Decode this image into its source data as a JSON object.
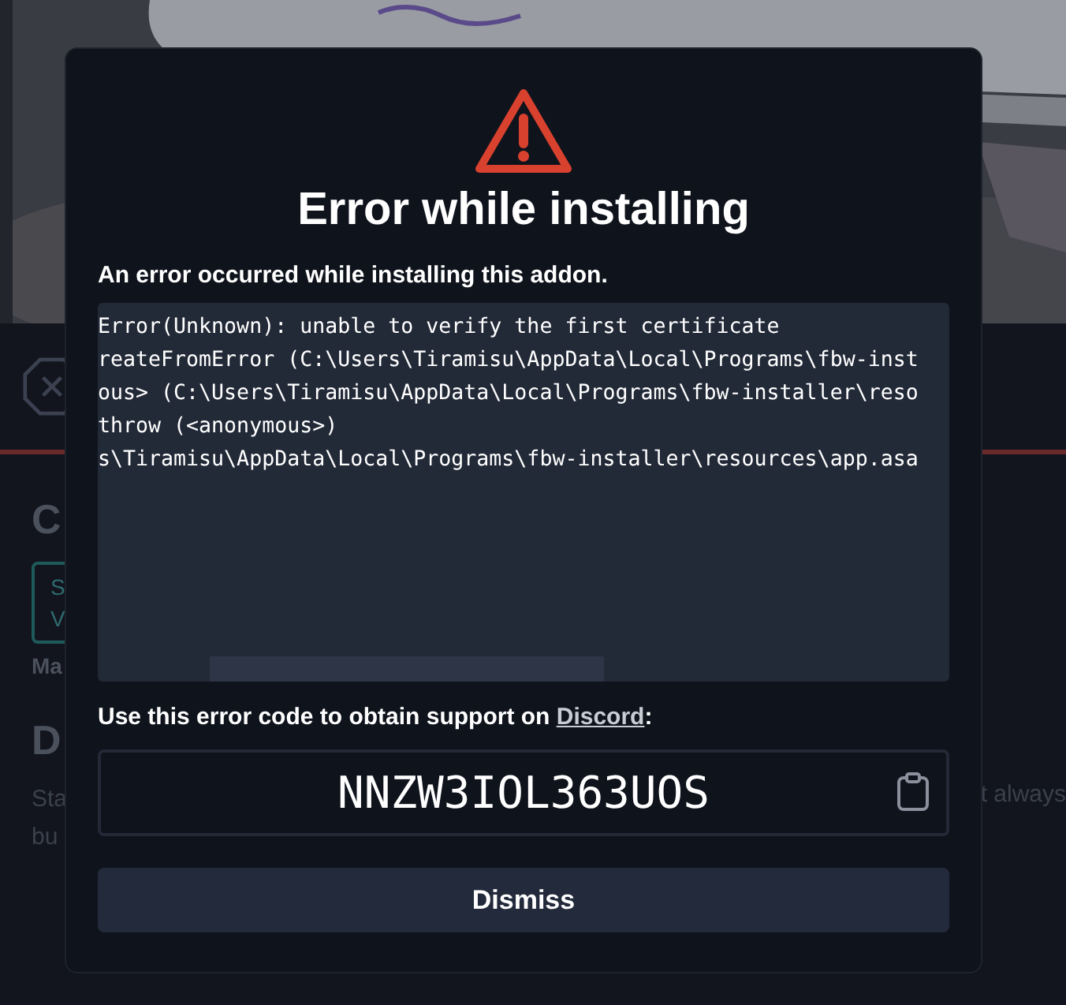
{
  "background": {
    "heading": "C",
    "badge_lines": [
      "S",
      "V"
    ],
    "label": "Ma",
    "section_heading": "D",
    "description_lines": [
      "Sta",
      "bu"
    ],
    "description_right": "t always"
  },
  "dialog": {
    "title": "Error while installing",
    "message": "An error occurred while installing this addon.",
    "log_lines": [
      "Error(Unknown): unable to verify the first certificate",
      "reateFromError (C:\\Users\\Tiramisu\\AppData\\Local\\Programs\\fbw-inst",
      "ous> (C:\\Users\\Tiramisu\\AppData\\Local\\Programs\\fbw-installer\\reso",
      "throw (<anonymous>)",
      "s\\Tiramisu\\AppData\\Local\\Programs\\fbw-installer\\resources\\app.asa"
    ],
    "support_text": "Use this error code to obtain support on ",
    "support_link": "Discord",
    "support_suffix": ":",
    "error_code": "NNZW3IOL363UOS",
    "dismiss_button": "Dismiss"
  }
}
